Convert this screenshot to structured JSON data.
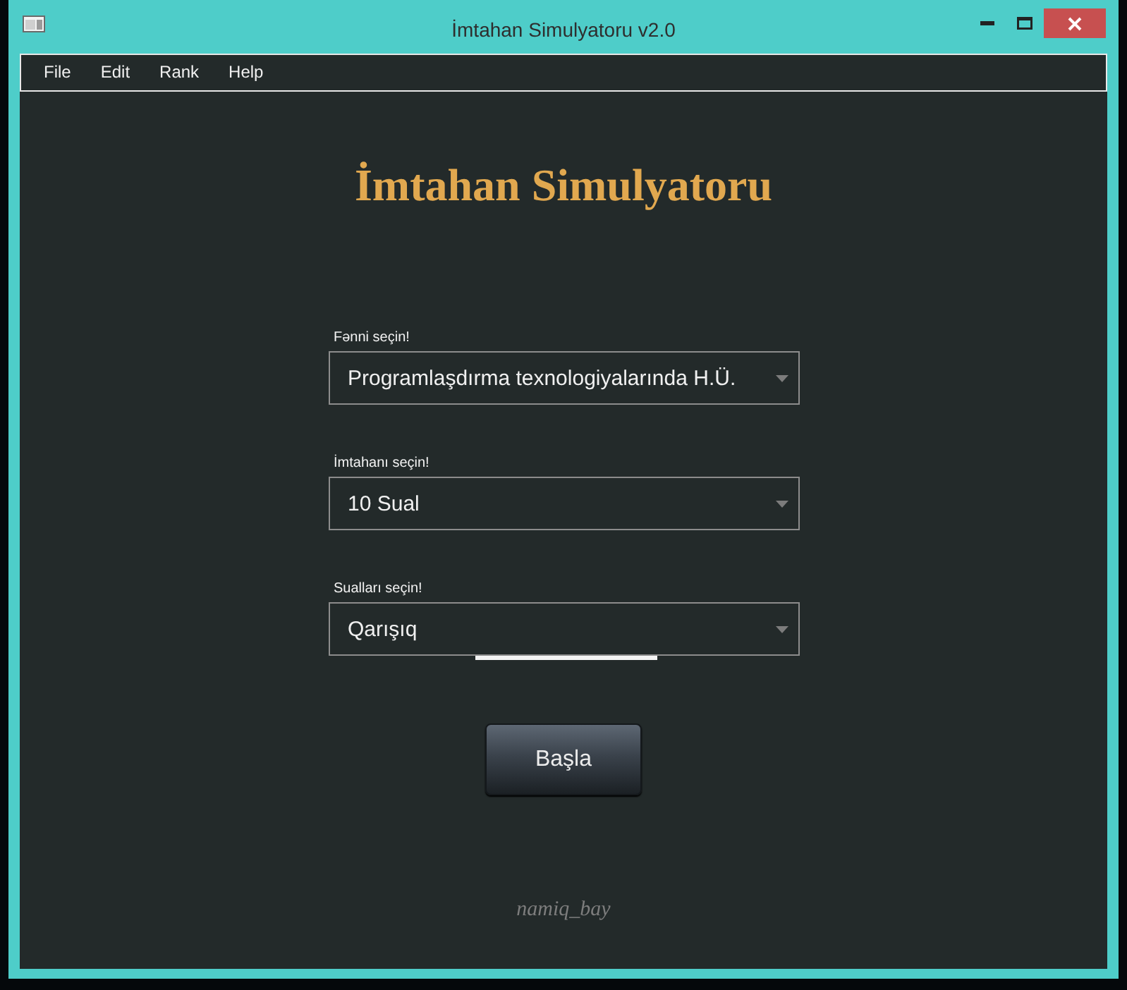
{
  "window": {
    "title": "İmtahan Simulyatoru v2.0"
  },
  "menu": [
    "File",
    "Edit",
    "Rank",
    "Help"
  ],
  "heading": "İmtahan Simulyatoru",
  "selects": [
    {
      "label": "Fənni seçin!",
      "value": "Programlaşdırma texnologiyalarında H.Ü."
    },
    {
      "label": "İmtahanı seçin!",
      "value": "10 Sual"
    },
    {
      "label": "Sualları seçin!",
      "value": "Qarışıq"
    }
  ],
  "start_button": "Başla",
  "author": "namiq_bay"
}
